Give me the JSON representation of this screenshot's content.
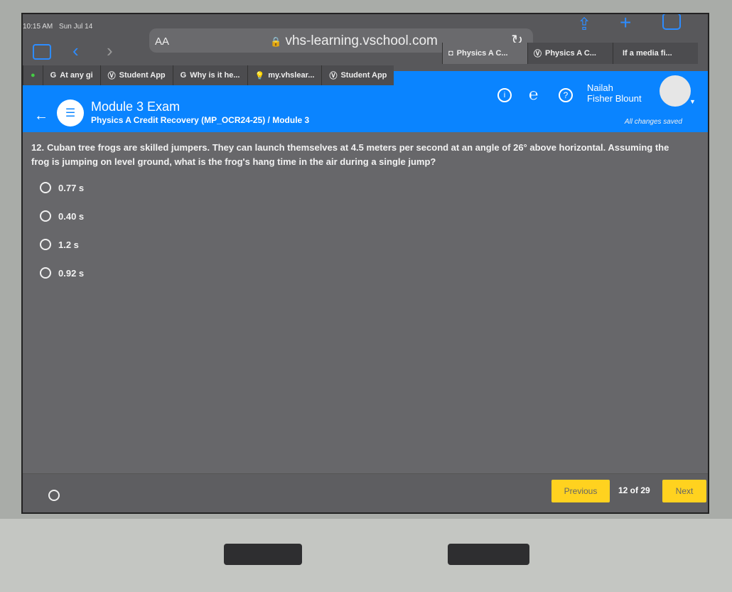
{
  "status_bar": {
    "time": "10:15 AM",
    "date": "Sun Jul 14"
  },
  "browser": {
    "text_size_label": "AA",
    "url": "vhs-learning.vschool.com",
    "tabs": [
      {
        "label": "Physics A C...",
        "active": true
      },
      {
        "label": "Physics A C...",
        "active": false
      },
      {
        "label": "If a media fi...",
        "active": false
      }
    ],
    "bookmarks": [
      {
        "label": "At any gi"
      },
      {
        "label": "Student App"
      },
      {
        "label": "Why is it he..."
      },
      {
        "label": "my.vhslear..."
      },
      {
        "label": "Student App"
      }
    ]
  },
  "header": {
    "title": "Module 3 Exam",
    "breadcrumb": "Physics A Credit Recovery (MP_OCR24-25) / Module 3",
    "user_first": "Nailah",
    "user_last": "Fisher Blount",
    "save_status": "All changes saved",
    "accent": "#0a84ff"
  },
  "question": {
    "number": "12.",
    "text": "Cuban tree frogs are skilled jumpers. They can launch themselves at 4.5 meters per second at an angle of 26° above horizontal. Assuming the frog is jumping on level ground, what is the frog's hang time in the air during a single jump?",
    "options": [
      "0.77 s",
      "0.40 s",
      "1.2 s",
      "0.92 s"
    ]
  },
  "footer": {
    "previous_label": "Previous",
    "page_indicator": "12 of 29",
    "next_label": "Next",
    "button_color": "#ffd21f"
  }
}
